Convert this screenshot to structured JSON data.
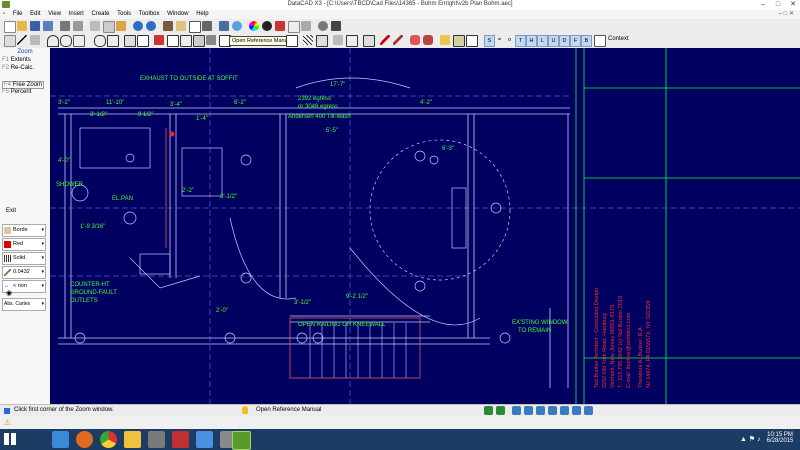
{
  "window": {
    "title": "DataCAD X3 - [C:\\Users\\TBCD\\Cad Files\\14365 - Bohm Enright\\v2b Plan Bohm.aec]"
  },
  "menu": [
    "File",
    "Edit",
    "View",
    "Insert",
    "Create",
    "Tools",
    "Toolbox",
    "Window",
    "Help"
  ],
  "toolbar": {
    "tooltip": "Open Reference Manual",
    "context_label": "Context",
    "view_letters": [
      "S",
      "=",
      "o",
      "T",
      "H",
      "L",
      "U",
      "D",
      "F",
      "B"
    ]
  },
  "left_panel": {
    "header": "Zoom",
    "items": [
      {
        "key": "F1",
        "label": "Extents"
      },
      {
        "key": "F2",
        "label": "Re-Calc."
      },
      {
        "key": "F4",
        "label": "Free Zoom"
      },
      {
        "key": "F5",
        "label": "Percent"
      }
    ],
    "exit": "Exit",
    "props": [
      {
        "label": "Borde"
      },
      {
        "label": "Red",
        "color": "#e00000"
      },
      {
        "label": "Solid"
      },
      {
        "label": "0.0432"
      },
      {
        "label": "< non"
      },
      {
        "label": "Abs. Cartes"
      }
    ]
  },
  "drawing": {
    "texts": [
      "11'-10\"",
      "EXHAUST TO OUTSIDE AT SOFFIT",
      "17'-7\"",
      "2392 egress",
      "or 3048 egress",
      "Andersen 400 Tilt-wash",
      "3'-2\"",
      "3'-1/2\"",
      "4'-2\"",
      "9 1/2\"",
      "6'-2\"",
      "5'-5\"",
      "3'-4\"",
      "1'-4\"",
      "4'-0\"",
      "2'-2\"",
      "SHOWER",
      "EL.PAN",
      "3'-1/2\"",
      "1'-9 3/16\"",
      "COUNTER-HT",
      "GROUND-FAULT",
      "OUTLETS",
      "2'-0\"",
      "9'-2 1/2\"",
      "3'-1/2\"",
      "OPEN RAILING OR KNEEWALL",
      "EX'STING WINDOW",
      "TO REMAIN",
      "6'-3\""
    ],
    "titleblock": [
      "Ted Bunker Architect - Consulting Design",
      "2252 Old York Road, Hamburg",
      "Vermont, New Jersey 08551-9178",
      "T.: 215.795.5942   (c) Ted Bunker 2013",
      "E-mail: tbunker@architect.com",
      "Theodore A. Bunker, R.A.",
      "NJ 14974, PA 015557X, NY 022359"
    ]
  },
  "status": {
    "prompt": "Click first corner of the Zoom window.",
    "hint": "Open Reference Manual"
  },
  "taskbar": {
    "time": "10:15 PM",
    "date": "6/28/2015"
  }
}
